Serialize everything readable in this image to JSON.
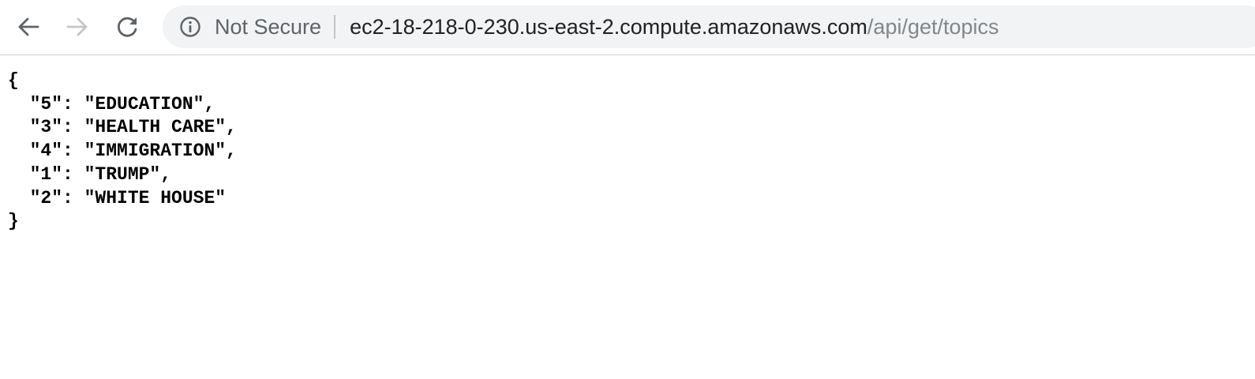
{
  "browser": {
    "security_label": "Not Secure",
    "url_host": "ec2-18-218-0-230.us-east-2.compute.amazonaws.com",
    "url_path": "/api/get/topics",
    "icons": {
      "back": "back-arrow-icon",
      "forward": "forward-arrow-icon",
      "reload": "reload-icon",
      "info": "info-icon"
    }
  },
  "response": {
    "open_brace": "{",
    "lines": [
      "  \"5\": \"EDUCATION\",",
      "  \"3\": \"HEALTH CARE\",",
      "  \"4\": \"IMMIGRATION\",",
      "  \"1\": \"TRUMP\",",
      "  \"2\": \"WHITE HOUSE\""
    ],
    "close_brace": "}"
  }
}
